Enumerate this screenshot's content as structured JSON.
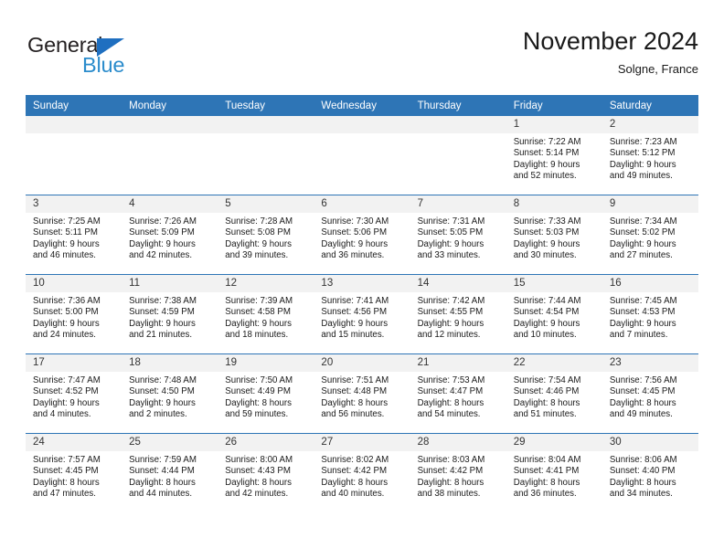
{
  "logo": {
    "word_one": "General",
    "word_two": "Blue",
    "triangle_color": "#1f6fc0",
    "word_two_color": "#2b8ccc",
    "word_one_color": "#231f20"
  },
  "header": {
    "month_title": "November 2024",
    "location": "Solgne, France"
  },
  "colors": {
    "header_blue": "#2e75b6",
    "daynum_strip": "#f2f2f2",
    "text": "#1a1a1a"
  },
  "weekday_headers": [
    "Sunday",
    "Monday",
    "Tuesday",
    "Wednesday",
    "Thursday",
    "Friday",
    "Saturday"
  ],
  "weeks": [
    [
      {
        "day": "",
        "empty": true,
        "sunrise": "",
        "sunset": "",
        "daylight_line1": "",
        "daylight_line2": ""
      },
      {
        "day": "",
        "empty": true,
        "sunrise": "",
        "sunset": "",
        "daylight_line1": "",
        "daylight_line2": ""
      },
      {
        "day": "",
        "empty": true,
        "sunrise": "",
        "sunset": "",
        "daylight_line1": "",
        "daylight_line2": ""
      },
      {
        "day": "",
        "empty": true,
        "sunrise": "",
        "sunset": "",
        "daylight_line1": "",
        "daylight_line2": ""
      },
      {
        "day": "",
        "empty": true,
        "sunrise": "",
        "sunset": "",
        "daylight_line1": "",
        "daylight_line2": ""
      },
      {
        "day": "1",
        "empty": false,
        "sunrise": "Sunrise: 7:22 AM",
        "sunset": "Sunset: 5:14 PM",
        "daylight_line1": "Daylight: 9 hours",
        "daylight_line2": "and 52 minutes."
      },
      {
        "day": "2",
        "empty": false,
        "sunrise": "Sunrise: 7:23 AM",
        "sunset": "Sunset: 5:12 PM",
        "daylight_line1": "Daylight: 9 hours",
        "daylight_line2": "and 49 minutes."
      }
    ],
    [
      {
        "day": "3",
        "empty": false,
        "sunrise": "Sunrise: 7:25 AM",
        "sunset": "Sunset: 5:11 PM",
        "daylight_line1": "Daylight: 9 hours",
        "daylight_line2": "and 46 minutes."
      },
      {
        "day": "4",
        "empty": false,
        "sunrise": "Sunrise: 7:26 AM",
        "sunset": "Sunset: 5:09 PM",
        "daylight_line1": "Daylight: 9 hours",
        "daylight_line2": "and 42 minutes."
      },
      {
        "day": "5",
        "empty": false,
        "sunrise": "Sunrise: 7:28 AM",
        "sunset": "Sunset: 5:08 PM",
        "daylight_line1": "Daylight: 9 hours",
        "daylight_line2": "and 39 minutes."
      },
      {
        "day": "6",
        "empty": false,
        "sunrise": "Sunrise: 7:30 AM",
        "sunset": "Sunset: 5:06 PM",
        "daylight_line1": "Daylight: 9 hours",
        "daylight_line2": "and 36 minutes."
      },
      {
        "day": "7",
        "empty": false,
        "sunrise": "Sunrise: 7:31 AM",
        "sunset": "Sunset: 5:05 PM",
        "daylight_line1": "Daylight: 9 hours",
        "daylight_line2": "and 33 minutes."
      },
      {
        "day": "8",
        "empty": false,
        "sunrise": "Sunrise: 7:33 AM",
        "sunset": "Sunset: 5:03 PM",
        "daylight_line1": "Daylight: 9 hours",
        "daylight_line2": "and 30 minutes."
      },
      {
        "day": "9",
        "empty": false,
        "sunrise": "Sunrise: 7:34 AM",
        "sunset": "Sunset: 5:02 PM",
        "daylight_line1": "Daylight: 9 hours",
        "daylight_line2": "and 27 minutes."
      }
    ],
    [
      {
        "day": "10",
        "empty": false,
        "sunrise": "Sunrise: 7:36 AM",
        "sunset": "Sunset: 5:00 PM",
        "daylight_line1": "Daylight: 9 hours",
        "daylight_line2": "and 24 minutes."
      },
      {
        "day": "11",
        "empty": false,
        "sunrise": "Sunrise: 7:38 AM",
        "sunset": "Sunset: 4:59 PM",
        "daylight_line1": "Daylight: 9 hours",
        "daylight_line2": "and 21 minutes."
      },
      {
        "day": "12",
        "empty": false,
        "sunrise": "Sunrise: 7:39 AM",
        "sunset": "Sunset: 4:58 PM",
        "daylight_line1": "Daylight: 9 hours",
        "daylight_line2": "and 18 minutes."
      },
      {
        "day": "13",
        "empty": false,
        "sunrise": "Sunrise: 7:41 AM",
        "sunset": "Sunset: 4:56 PM",
        "daylight_line1": "Daylight: 9 hours",
        "daylight_line2": "and 15 minutes."
      },
      {
        "day": "14",
        "empty": false,
        "sunrise": "Sunrise: 7:42 AM",
        "sunset": "Sunset: 4:55 PM",
        "daylight_line1": "Daylight: 9 hours",
        "daylight_line2": "and 12 minutes."
      },
      {
        "day": "15",
        "empty": false,
        "sunrise": "Sunrise: 7:44 AM",
        "sunset": "Sunset: 4:54 PM",
        "daylight_line1": "Daylight: 9 hours",
        "daylight_line2": "and 10 minutes."
      },
      {
        "day": "16",
        "empty": false,
        "sunrise": "Sunrise: 7:45 AM",
        "sunset": "Sunset: 4:53 PM",
        "daylight_line1": "Daylight: 9 hours",
        "daylight_line2": "and 7 minutes."
      }
    ],
    [
      {
        "day": "17",
        "empty": false,
        "sunrise": "Sunrise: 7:47 AM",
        "sunset": "Sunset: 4:52 PM",
        "daylight_line1": "Daylight: 9 hours",
        "daylight_line2": "and 4 minutes."
      },
      {
        "day": "18",
        "empty": false,
        "sunrise": "Sunrise: 7:48 AM",
        "sunset": "Sunset: 4:50 PM",
        "daylight_line1": "Daylight: 9 hours",
        "daylight_line2": "and 2 minutes."
      },
      {
        "day": "19",
        "empty": false,
        "sunrise": "Sunrise: 7:50 AM",
        "sunset": "Sunset: 4:49 PM",
        "daylight_line1": "Daylight: 8 hours",
        "daylight_line2": "and 59 minutes."
      },
      {
        "day": "20",
        "empty": false,
        "sunrise": "Sunrise: 7:51 AM",
        "sunset": "Sunset: 4:48 PM",
        "daylight_line1": "Daylight: 8 hours",
        "daylight_line2": "and 56 minutes."
      },
      {
        "day": "21",
        "empty": false,
        "sunrise": "Sunrise: 7:53 AM",
        "sunset": "Sunset: 4:47 PM",
        "daylight_line1": "Daylight: 8 hours",
        "daylight_line2": "and 54 minutes."
      },
      {
        "day": "22",
        "empty": false,
        "sunrise": "Sunrise: 7:54 AM",
        "sunset": "Sunset: 4:46 PM",
        "daylight_line1": "Daylight: 8 hours",
        "daylight_line2": "and 51 minutes."
      },
      {
        "day": "23",
        "empty": false,
        "sunrise": "Sunrise: 7:56 AM",
        "sunset": "Sunset: 4:45 PM",
        "daylight_line1": "Daylight: 8 hours",
        "daylight_line2": "and 49 minutes."
      }
    ],
    [
      {
        "day": "24",
        "empty": false,
        "sunrise": "Sunrise: 7:57 AM",
        "sunset": "Sunset: 4:45 PM",
        "daylight_line1": "Daylight: 8 hours",
        "daylight_line2": "and 47 minutes."
      },
      {
        "day": "25",
        "empty": false,
        "sunrise": "Sunrise: 7:59 AM",
        "sunset": "Sunset: 4:44 PM",
        "daylight_line1": "Daylight: 8 hours",
        "daylight_line2": "and 44 minutes."
      },
      {
        "day": "26",
        "empty": false,
        "sunrise": "Sunrise: 8:00 AM",
        "sunset": "Sunset: 4:43 PM",
        "daylight_line1": "Daylight: 8 hours",
        "daylight_line2": "and 42 minutes."
      },
      {
        "day": "27",
        "empty": false,
        "sunrise": "Sunrise: 8:02 AM",
        "sunset": "Sunset: 4:42 PM",
        "daylight_line1": "Daylight: 8 hours",
        "daylight_line2": "and 40 minutes."
      },
      {
        "day": "28",
        "empty": false,
        "sunrise": "Sunrise: 8:03 AM",
        "sunset": "Sunset: 4:42 PM",
        "daylight_line1": "Daylight: 8 hours",
        "daylight_line2": "and 38 minutes."
      },
      {
        "day": "29",
        "empty": false,
        "sunrise": "Sunrise: 8:04 AM",
        "sunset": "Sunset: 4:41 PM",
        "daylight_line1": "Daylight: 8 hours",
        "daylight_line2": "and 36 minutes."
      },
      {
        "day": "30",
        "empty": false,
        "sunrise": "Sunrise: 8:06 AM",
        "sunset": "Sunset: 4:40 PM",
        "daylight_line1": "Daylight: 8 hours",
        "daylight_line2": "and 34 minutes."
      }
    ]
  ]
}
